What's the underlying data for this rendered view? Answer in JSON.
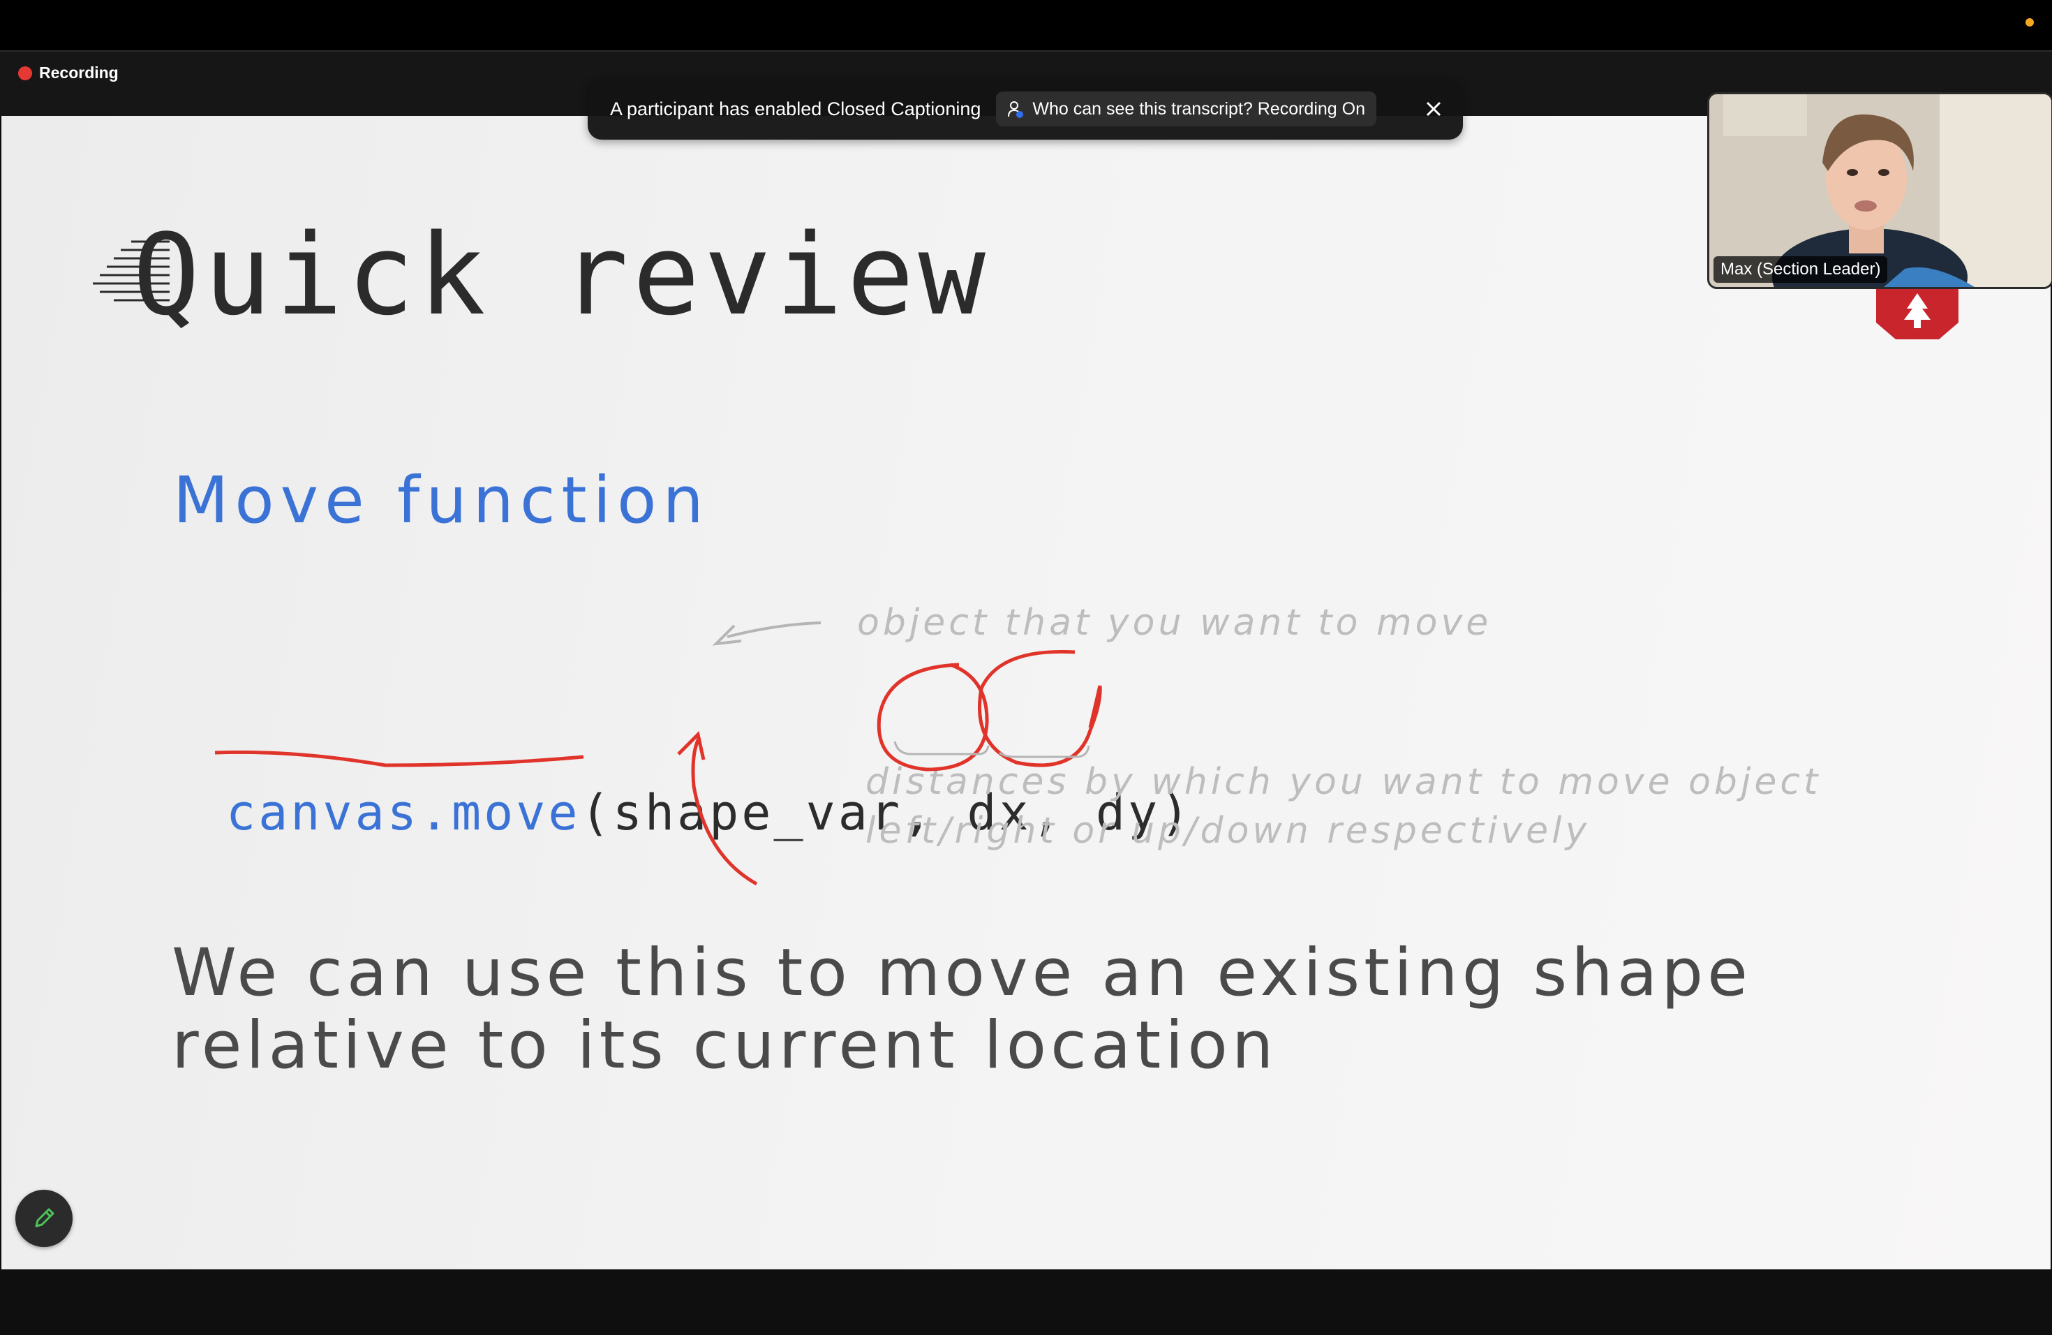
{
  "recording": {
    "label": "Recording"
  },
  "cc_banner": {
    "message": "A participant has enabled Closed Captioning",
    "transcript_button": "Who can see this transcript? Recording On"
  },
  "video": {
    "participant_name": "Max (Section Leader)"
  },
  "slide": {
    "title": "Quick review",
    "subtitle": "Move function",
    "code": {
      "function": "canvas.move",
      "args": "(shape_var, dx, dy)"
    },
    "annotations": {
      "object_note": "object that you want to move",
      "distance_note_line1": "distances by which you want to move object",
      "distance_note_line2": "left/right or up/down respectively"
    },
    "body_line1": "We can use this to move an existing shape",
    "body_line2": "relative to its current location"
  },
  "colors": {
    "accent_blue": "#3a72d6",
    "ink_red": "#e0342b",
    "recording_red": "#e53935",
    "notification_dot": "#f5a623"
  },
  "icons": {
    "recording": "recording-dot-icon",
    "transcript": "person-info-icon",
    "close": "close-icon",
    "annotate": "pencil-icon",
    "logo": "shield-logo-icon"
  }
}
